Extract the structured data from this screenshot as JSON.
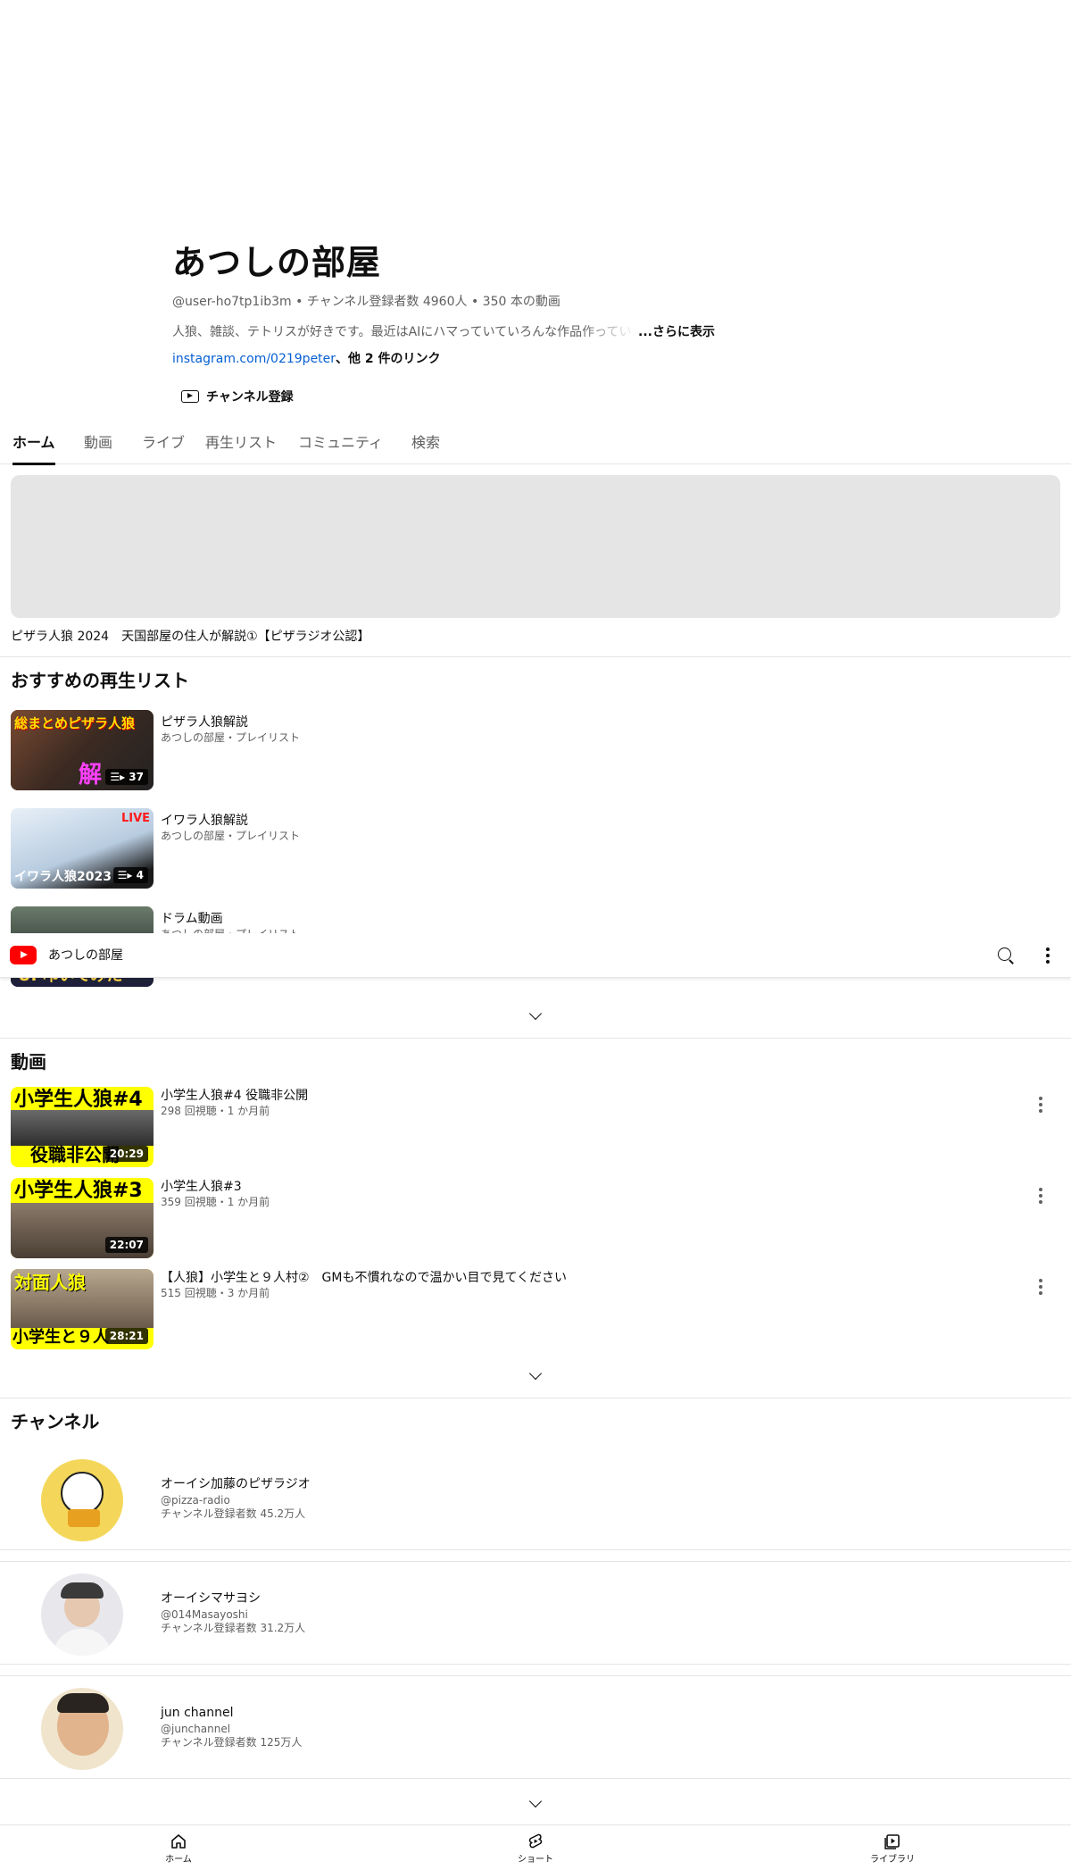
{
  "channel": {
    "name": "あつしの部屋",
    "handle": "@user-ho7tp1ib3m",
    "subscribers": "チャンネル登録者数 4960人",
    "video_count": "350 本の動画",
    "meta_sep": " • ",
    "description": "人狼、雑談、テトリスが好きです。最近はAIにハマっていていろんな作品作っています",
    "more_label": "...さらに表示",
    "link": "instagram.com/0219peter",
    "other_links": "、他 2 件のリンク",
    "subscribe_label": "チャンネル登録"
  },
  "tabs": [
    {
      "label": "ホーム",
      "active": true
    },
    {
      "label": "動画"
    },
    {
      "label": "ライブ"
    },
    {
      "label": "再生リスト"
    },
    {
      "label": "コミュニティ"
    },
    {
      "label": "検索"
    }
  ],
  "featured": {
    "title": "ピザラ人狼 2024　天国部屋の住人が解説①【ピザラジオ公認】"
  },
  "playlists_section": {
    "title": "おすすめの再生リスト",
    "items": [
      {
        "title": "ピザラ人狼解説",
        "sub": "あつしの部屋・プレイリスト",
        "count": "37",
        "caption": "総まとめピザラ人狼",
        "caption2": "解"
      },
      {
        "title": "イワラ人狼解説",
        "sub": "あつしの部屋・プレイリスト",
        "count": "4",
        "caption": "イワラ人狼2023",
        "badge": "LIVE"
      },
      {
        "title": "ドラム動画",
        "sub": "あつしの部屋・プレイリスト",
        "caption": "UP叩いてみた"
      }
    ]
  },
  "sticky": {
    "title": "あつしの部屋"
  },
  "videos_section": {
    "title": "動画",
    "items": [
      {
        "title": "小学生人狼#4 役職非公開",
        "sub": "298 回視聴・1 か月前",
        "duration": "20:29",
        "caption_top": "小学生人狼#4",
        "caption_bottom": "役職非公開"
      },
      {
        "title": "小学生人狼#3",
        "sub": "359 回視聴・1 か月前",
        "duration": "22:07",
        "caption_top": "小学生人狼#3"
      },
      {
        "title": "【人狼】小学生と９人村②　GMも不慣れなので温かい目で見てください",
        "sub": "515 回視聴・3 か月前",
        "duration": "28:21",
        "caption_top": "対面人狼",
        "caption_bottom": "小学生と９人"
      }
    ]
  },
  "channels_section": {
    "title": "チャンネル",
    "items": [
      {
        "name": "オーイシ加藤のピザラジオ",
        "handle": "@pizza-radio",
        "subs": "チャンネル登録者数 45.2万人"
      },
      {
        "name": "オーイシマサヨシ",
        "handle": "@014Masayoshi",
        "subs": "チャンネル登録者数 31.2万人"
      },
      {
        "name": "jun channel",
        "handle": "@junchannel",
        "subs": "チャンネル登録者数 125万人"
      }
    ]
  },
  "bottom_nav": [
    {
      "label": "ホーム",
      "icon": "home-icon"
    },
    {
      "label": "ショート",
      "icon": "shorts-icon"
    },
    {
      "label": "ライブラリ",
      "icon": "library-icon"
    }
  ],
  "colors": {
    "brand": "#ff0000",
    "link": "#065fd4",
    "secondary_text": "#606060",
    "thumb_yellow": "#ffff00"
  }
}
